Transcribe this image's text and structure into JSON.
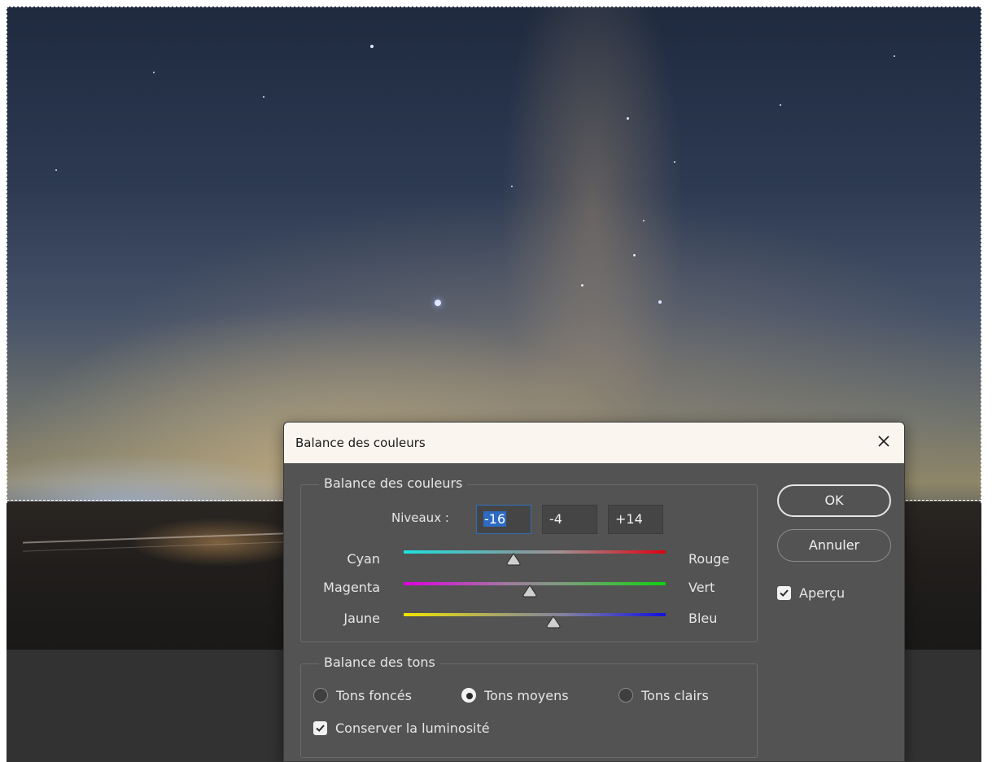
{
  "dialog": {
    "title": "Balance des couleurs",
    "close_icon": "close-icon"
  },
  "color_balance": {
    "group_label": "Balance des couleurs",
    "levels_label": "Niveaux :",
    "levels": [
      "-16",
      "-4",
      "+14"
    ],
    "sliders": [
      {
        "left": "Cyan",
        "right": "Rouge",
        "value": -16,
        "min": -100,
        "max": 100,
        "left_color": "#1fe0e0",
        "right_color": "#e10010"
      },
      {
        "left": "Magenta",
        "right": "Vert",
        "value": -4,
        "min": -100,
        "max": 100,
        "left_color": "#e000e0",
        "right_color": "#10d010"
      },
      {
        "left": "Jaune",
        "right": "Bleu",
        "value": 14,
        "min": -100,
        "max": 100,
        "left_color": "#f2e400",
        "right_color": "#1010e0"
      }
    ]
  },
  "tone_balance": {
    "group_label": "Balance des tons",
    "options": [
      "Tons foncés",
      "Tons moyens",
      "Tons clairs"
    ],
    "selected": "Tons moyens",
    "preserve_luminosity_label": "Conserver la luminosité",
    "preserve_luminosity_checked": true
  },
  "buttons": {
    "ok_label": "OK",
    "cancel_label": "Annuler"
  },
  "preview": {
    "label": "Aperçu",
    "checked": true
  },
  "colors": {
    "dialog_bg": "#535353",
    "titlebar_bg": "#fbf5ef",
    "selection_highlight": "#2d6ac2"
  }
}
